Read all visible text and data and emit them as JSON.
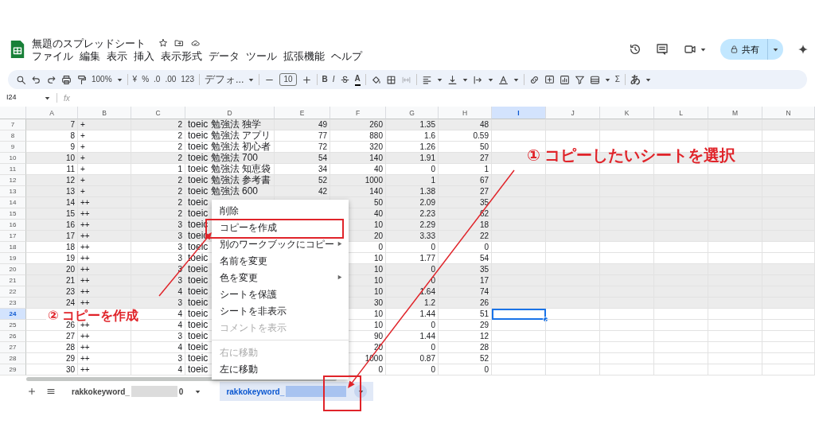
{
  "title": "無題のスプレッドシート",
  "menu": [
    "ファイル",
    "編集",
    "表示",
    "挿入",
    "表示形式",
    "データ",
    "ツール",
    "拡張機能",
    "ヘルプ"
  ],
  "share_button": "共有",
  "toolbar": {
    "zoom": "100%",
    "currency": "¥",
    "percent": "%",
    "decimal_decrease": ".0",
    "decimal_increase": ".00",
    "number_format": "123",
    "font": "デフォ...",
    "font_size": "10",
    "bold": "B",
    "italic": "I",
    "text_color": "A",
    "sum": "Σ",
    "input_tools": "あ"
  },
  "name_box": "I24",
  "formula_label": "fx",
  "columns": [
    {
      "label": "A",
      "selected": false
    },
    {
      "label": "B",
      "selected": false
    },
    {
      "label": "C",
      "selected": false
    },
    {
      "label": "D",
      "selected": false
    },
    {
      "label": "E",
      "selected": false
    },
    {
      "label": "F",
      "selected": false
    },
    {
      "label": "G",
      "selected": false
    },
    {
      "label": "H",
      "selected": false
    },
    {
      "label": "I",
      "selected": true
    },
    {
      "label": "J",
      "selected": false
    },
    {
      "label": "K",
      "selected": false
    },
    {
      "label": "L",
      "selected": false
    },
    {
      "label": "M",
      "selected": false
    },
    {
      "label": "N",
      "selected": false
    }
  ],
  "rows": [
    {
      "header": "7",
      "shaded": true,
      "selected": false,
      "a": "7",
      "b": "+",
      "c": "2",
      "d": "toeic 勉強法 独学",
      "e": "49",
      "f": "260",
      "g": "1.35",
      "h": "48"
    },
    {
      "header": "8",
      "shaded": false,
      "selected": false,
      "a": "8",
      "b": "+",
      "c": "2",
      "d": "toeic 勉強法 アプリ",
      "e": "77",
      "f": "880",
      "g": "1.6",
      "h": "0.59"
    },
    {
      "header": "9",
      "shaded": false,
      "selected": false,
      "a": "9",
      "b": "+",
      "c": "2",
      "d": "toeic 勉強法 初心者",
      "e": "72",
      "f": "320",
      "g": "1.26",
      "h": "50"
    },
    {
      "header": "10",
      "shaded": true,
      "selected": false,
      "a": "10",
      "b": "+",
      "c": "2",
      "d": "toeic 勉強法 700",
      "e": "54",
      "f": "140",
      "g": "1.91",
      "h": "27"
    },
    {
      "header": "11",
      "shaded": false,
      "selected": false,
      "a": "11",
      "b": "+",
      "c": "1",
      "d": "toeic 勉強法 知恵袋",
      "e": "34",
      "f": "40",
      "g": "0",
      "h": "1"
    },
    {
      "header": "12",
      "shaded": true,
      "selected": false,
      "a": "12",
      "b": "+",
      "c": "2",
      "d": "toeic 勉強法 参考書",
      "e": "52",
      "f": "1000",
      "g": "1",
      "h": "67"
    },
    {
      "header": "13",
      "shaded": true,
      "selected": false,
      "a": "13",
      "b": "+",
      "c": "2",
      "d": "toeic 勉強法 600",
      "e": "42",
      "f": "140",
      "g": "1.38",
      "h": "27"
    },
    {
      "header": "14",
      "shaded": true,
      "selected": false,
      "a": "14",
      "b": "++",
      "c": "2",
      "d": "toeic",
      "f": "50",
      "g": "2.09",
      "h": "35"
    },
    {
      "header": "15",
      "shaded": true,
      "selected": false,
      "a": "15",
      "b": "++",
      "c": "2",
      "d": "toeic",
      "f": "40",
      "g": "2.23",
      "h": "62"
    },
    {
      "header": "16",
      "shaded": true,
      "selected": false,
      "a": "16",
      "b": "++",
      "c": "3",
      "d": "toeic",
      "f": "10",
      "g": "2.29",
      "h": "18"
    },
    {
      "header": "17",
      "shaded": true,
      "selected": false,
      "a": "17",
      "b": "++",
      "c": "3",
      "d": "toeic",
      "f": "20",
      "g": "3.33",
      "h": "22"
    },
    {
      "header": "18",
      "shaded": false,
      "selected": false,
      "a": "18",
      "b": "++",
      "c": "3",
      "d": "toeic",
      "f": "0",
      "g": "0",
      "h": "0"
    },
    {
      "header": "19",
      "shaded": false,
      "selected": false,
      "a": "19",
      "b": "++",
      "c": "3",
      "d": "toeic",
      "f": "10",
      "g": "1.77",
      "h": "54"
    },
    {
      "header": "20",
      "shaded": true,
      "selected": false,
      "a": "20",
      "b": "++",
      "c": "3",
      "d": "toeic",
      "f": "10",
      "g": "0",
      "h": "35"
    },
    {
      "header": "21",
      "shaded": true,
      "selected": false,
      "a": "21",
      "b": "++",
      "c": "3",
      "d": "toeic",
      "f": "10",
      "g": "0",
      "h": "17"
    },
    {
      "header": "22",
      "shaded": true,
      "selected": false,
      "a": "23",
      "b": "++",
      "c": "4",
      "d": "toeic",
      "f": "10",
      "g": "1.64",
      "h": "74"
    },
    {
      "header": "23",
      "shaded": true,
      "selected": false,
      "a": "24",
      "b": "++",
      "c": "3",
      "d": "toeic",
      "f": "30",
      "g": "1.2",
      "h": "26"
    },
    {
      "header": "24",
      "shaded": false,
      "selected": true,
      "c": "4",
      "d": "toeic",
      "f": "10",
      "g": "1.44",
      "h": "51"
    },
    {
      "header": "25",
      "shaded": false,
      "selected": false,
      "a": "26",
      "b": "++",
      "c": "4",
      "d": "toeic",
      "f": "10",
      "g": "0",
      "h": "29"
    },
    {
      "header": "26",
      "shaded": false,
      "selected": false,
      "a": "27",
      "b": "++",
      "c": "3",
      "d": "toeic",
      "f": "90",
      "g": "1.44",
      "h": "12"
    },
    {
      "header": "27",
      "shaded": false,
      "selected": false,
      "a": "28",
      "b": "++",
      "c": "4",
      "d": "toeic",
      "f": "20",
      "g": "0",
      "h": "28"
    },
    {
      "header": "28",
      "shaded": false,
      "selected": false,
      "a": "29",
      "b": "++",
      "c": "3",
      "d": "toeic",
      "f": "1000",
      "g": "0.87",
      "h": "52"
    },
    {
      "header": "29",
      "shaded": false,
      "selected": false,
      "a": "30",
      "b": "++",
      "c": "4",
      "d": "toeic",
      "f": "0",
      "g": "0",
      "h": "0"
    }
  ],
  "context_menu": [
    {
      "kind": "item",
      "label": "削除",
      "submenu": false,
      "disabled": false
    },
    {
      "kind": "item",
      "label": "コピーを作成",
      "submenu": false,
      "disabled": false
    },
    {
      "kind": "item",
      "label": "別のワークブックにコピー",
      "submenu": true,
      "disabled": false
    },
    {
      "kind": "item",
      "label": "名前を変更",
      "submenu": false,
      "disabled": false
    },
    {
      "kind": "item",
      "label": "色を変更",
      "submenu": true,
      "disabled": false
    },
    {
      "kind": "item",
      "label": "シートを保護",
      "submenu": false,
      "disabled": false
    },
    {
      "kind": "item",
      "label": "シートを非表示",
      "submenu": false,
      "disabled": false
    },
    {
      "kind": "item",
      "label": "コメントを表示",
      "submenu": false,
      "disabled": true
    },
    {
      "kind": "divider"
    },
    {
      "kind": "item",
      "label": "右に移動",
      "submenu": false,
      "disabled": true
    },
    {
      "kind": "item",
      "label": "左に移動",
      "submenu": false,
      "disabled": false
    }
  ],
  "sheet_tabs": [
    {
      "label": "rakkokeyword_",
      "suffix": "0",
      "selected": false
    },
    {
      "label": "rakkokeyword_",
      "selected": true
    }
  ],
  "annotations": [
    {
      "text": "① コピーしたいシートを選択"
    },
    {
      "text": "② コピーを作成"
    }
  ]
}
